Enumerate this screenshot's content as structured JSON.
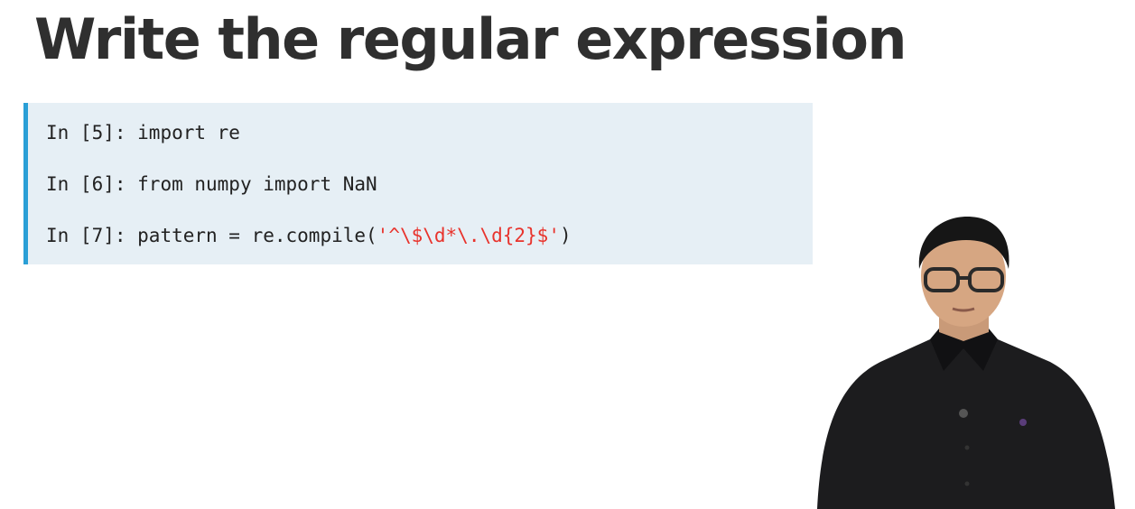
{
  "slide": {
    "title": "Write the regular expression"
  },
  "code": {
    "lines": [
      {
        "prompt": "In [5]: ",
        "code": "import re"
      },
      {
        "prompt": "In [6]: ",
        "code": "from numpy import NaN"
      },
      {
        "prompt": "In [7]: ",
        "code_pre": "pattern = re.compile(",
        "string": "'^\\$\\d*\\.\\d{2}$'",
        "code_post": ")"
      }
    ],
    "colors": {
      "background": "#e6eff5",
      "accent_bar": "#2a9fd6",
      "string": "#e8332c",
      "text": "#222222"
    }
  },
  "presenter": {
    "icon": "presenter-video-figure"
  }
}
